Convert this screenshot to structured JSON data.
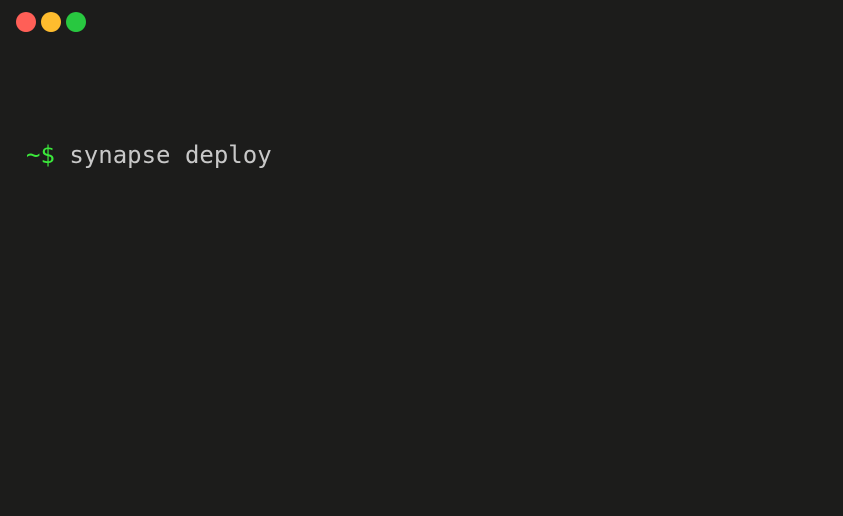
{
  "window": {
    "traffic_lights": {
      "close": {
        "color": "#ff5f57",
        "icon": "close-dot"
      },
      "minimize": {
        "color": "#febc2e",
        "icon": "minimize-dot"
      },
      "maximize": {
        "color": "#28c840",
        "icon": "maximize-dot"
      }
    },
    "background_color": "#1c1c1b"
  },
  "terminal": {
    "prompt": "~$",
    "command": "synapse deploy",
    "prompt_color": "#3be83b",
    "command_color": "#c8c8c8"
  }
}
